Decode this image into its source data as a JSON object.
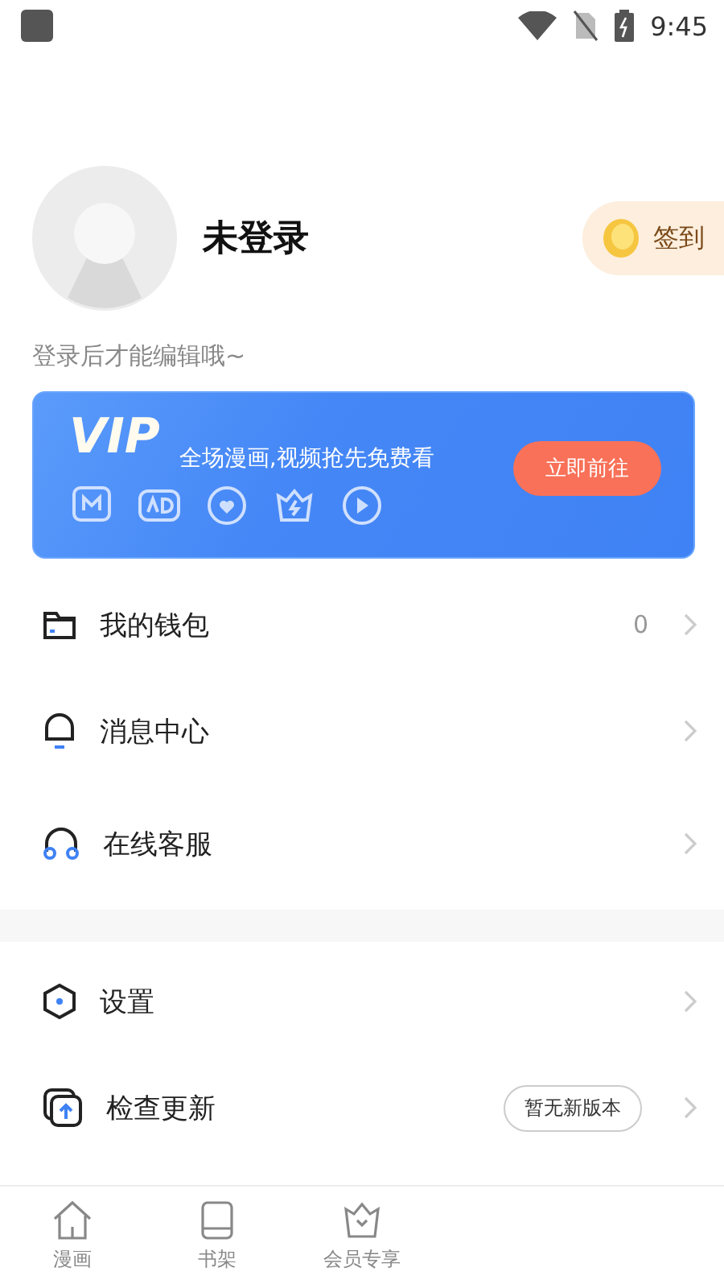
{
  "status_bar": {
    "time": "9:45"
  },
  "profile": {
    "name": "未登录",
    "hint": "登录后才能编辑哦~",
    "checkin": "签到"
  },
  "vip_banner": {
    "logo": "VIP",
    "slogan": "全场漫画,视频抢先免费看",
    "button": "立即前往"
  },
  "menu_groups": [
    {
      "items": [
        {
          "kind": "wallet",
          "label": "我的钱包",
          "value": "0"
        },
        {
          "kind": "bell",
          "label": "消息中心"
        },
        {
          "kind": "headset",
          "label": "在线客服"
        }
      ]
    },
    {
      "items": [
        {
          "kind": "gear",
          "label": "设置"
        },
        {
          "kind": "update",
          "label": "检查更新",
          "badge": "暂无新版本"
        }
      ]
    }
  ],
  "bottom_nav": [
    {
      "kind": "home",
      "label": "漫画",
      "selected": false
    },
    {
      "kind": "book",
      "label": "书架",
      "selected": false
    },
    {
      "kind": "crown",
      "label": "会员专享",
      "selected": false
    }
  ]
}
